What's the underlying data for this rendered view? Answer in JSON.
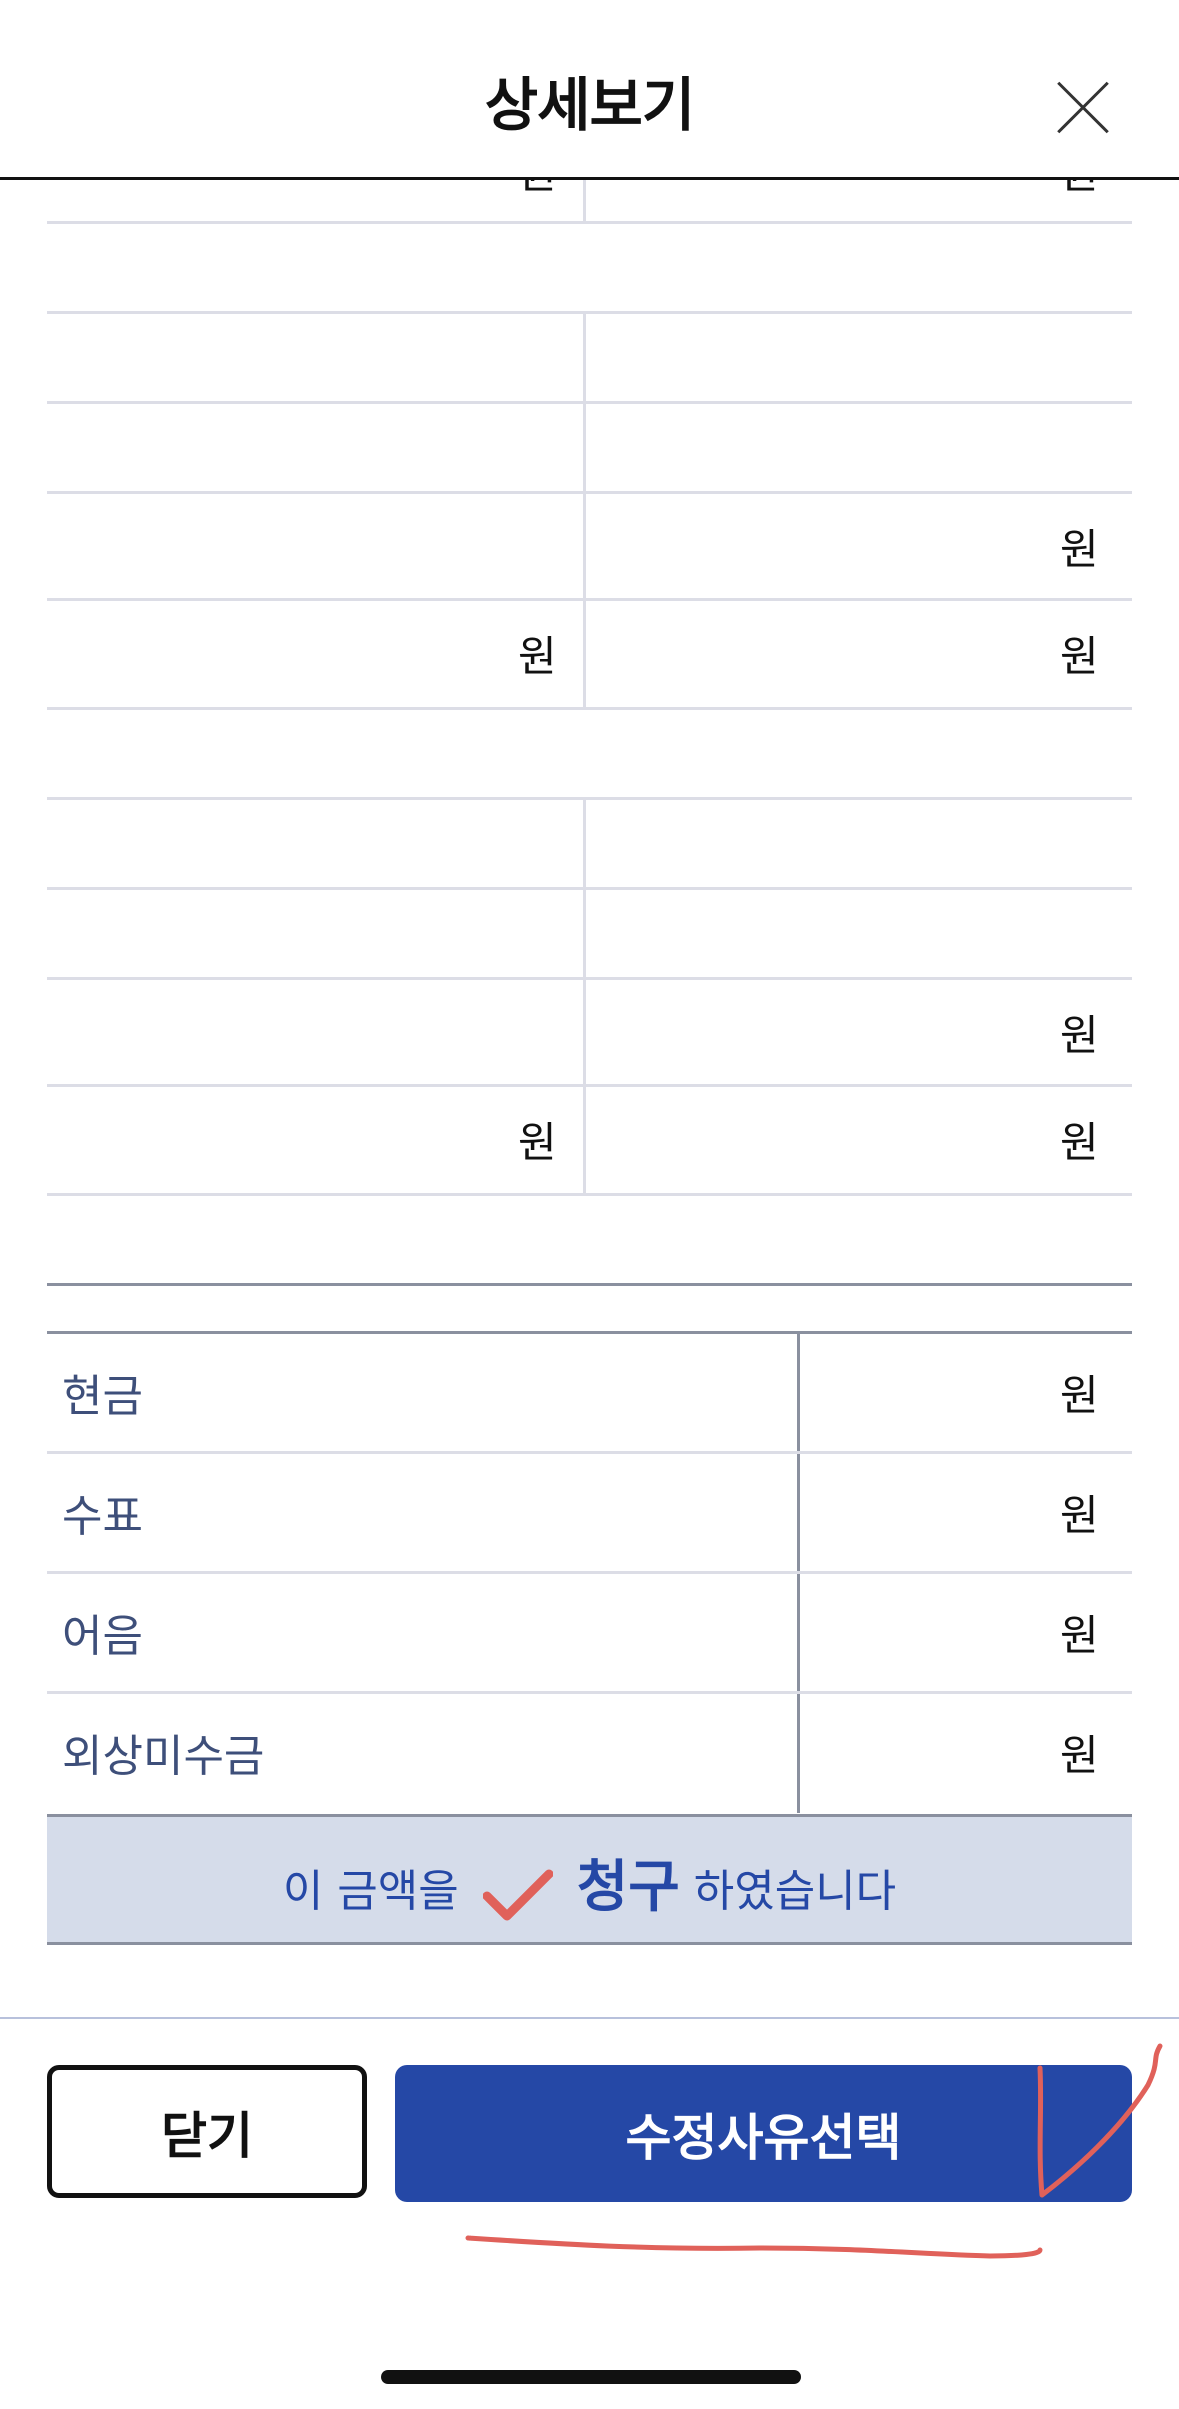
{
  "header": {
    "title": "상세보기"
  },
  "detail_table": {
    "won_unit": "원",
    "partial_top": {
      "left": "원",
      "right": "원"
    }
  },
  "payment": {
    "items": [
      {
        "label": "현금",
        "unit": "원"
      },
      {
        "label": "수표",
        "unit": "원"
      },
      {
        "label": "어음",
        "unit": "원"
      },
      {
        "label": "외상미수금",
        "unit": "원"
      }
    ]
  },
  "notice": {
    "prefix": "이 금액을",
    "emphasis": "청구",
    "suffix": "하였습니다"
  },
  "footer": {
    "close_label": "닫기",
    "select_label": "수정사유선택"
  },
  "colors": {
    "accent": "#2548a6",
    "annotation": "#e0615a",
    "notice_bg": "#d5dcea"
  }
}
